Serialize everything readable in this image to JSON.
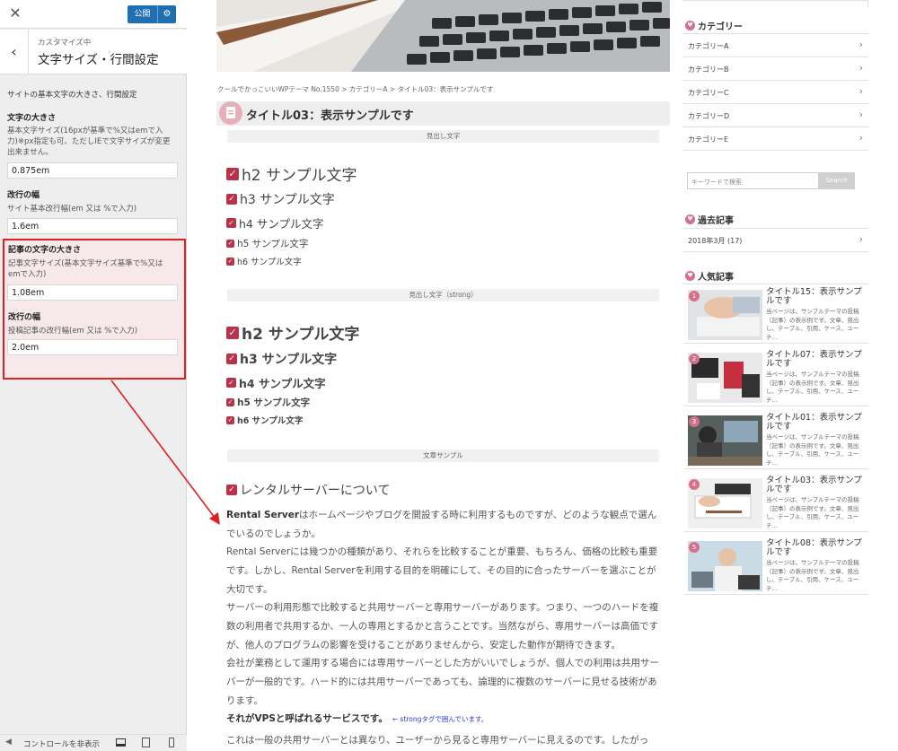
{
  "customizer": {
    "close_icon": "✕",
    "publish_label": "公開",
    "settings_icon": "⚙",
    "back_icon": "‹",
    "customizing_label": "カスタマイズ中",
    "section_title": "文字サイズ・行間設定",
    "section_desc": "サイトの基本文字の大きさ、行間設定",
    "site_font_size": {
      "heading": "文字の大きさ",
      "desc_lines": [
        "基本文字サイズ(16pxが基準で%又はemで入",
        "力)※px指定も可、ただしIEで文字サイズが変更",
        "出来ません。"
      ],
      "value": "0.875em"
    },
    "site_line_height": {
      "heading": "改行の幅",
      "desc": "サイト基本改行幅(em 又は %で入力)",
      "value": "1.6em"
    },
    "post_font_size": {
      "heading": "記事の文字の大きさ",
      "desc_lines": [
        "記事文字サイズ(基本文字サイズ基準で%又は",
        "emで入力)"
      ],
      "value": "1.08em"
    },
    "post_line_height": {
      "heading": "改行の幅",
      "desc": "投稿記事の改行幅(em 又は %で入力)",
      "value": "2.0em"
    },
    "footer": {
      "hide_controls_label": "コントロールを非表示",
      "device_icons": [
        "desktop-icon",
        "tablet-icon",
        "mobile-icon"
      ]
    }
  },
  "article": {
    "breadcrumb": "クールでかっこいいWPテーマ No.1550 > カテゴリーA > タイトル03：表示サンプルです",
    "title": "タイトル03：表示サンプルです",
    "cap_headings": "見出し文字",
    "headings": [
      "h2 サンプル文字",
      "h3 サンプル文字",
      "h4 サンプル文字",
      "h5 サンプル文字",
      "h6 サンプル文字"
    ],
    "cap_headings_strong": "見出し文字（strong）",
    "headings_strong": [
      "h2 サンプル文字",
      "h3 サンプル文字",
      "h4 サンプル文字",
      "h5 サンプル文字",
      "h6 サンプル文字"
    ],
    "cap_text_sample": "文章サンプル",
    "section_heading": "レンタルサーバーについて",
    "p1_strong": "Rental Server",
    "p1_rest": "はホームページやブログを開設する時に利用するものですが、どのような観点で選んでいるのでしょうか。",
    "p2": "Rental Serverには幾つかの種類があり、それらを比較することが重要、もちろん、価格の比較も重要です。しかし、Rental Serverを利用する目的を明確にして、その目的に合ったサーバーを選ぶことが大切です。",
    "p3": "サーバーの利用形態で比較すると共用サーバーと専用サーバーがあります。つまり、一つのハードを複数の利用者で共用するか、一人の専用とするかと言うことです。当然ながら、専用サーバーは高価ですが、他人のプログラムの影響を受けることがありませんから、安定した動作が期待できます。",
    "p4": "会社が業務として運用する場合には専用サーバーとした方がいいでしょうが、個人での利用は共用サーバーが一般的です。ハード的には共用サーバーであっても、論理的に複数のサーバーに見せる技術があります。",
    "p5_strong": "それがVPSと呼ばれるサービスです。",
    "p5_note": "← strongタグで囲んでいます。",
    "p6": "これは一般の共用サーバーとは異なり、ユーザーから見ると専用サーバーに見えるのです。したがっ"
  },
  "sidebar": {
    "categories_title": "カテゴリー",
    "categories": [
      "カテゴリーA",
      "カテゴリーB",
      "カテゴリーC",
      "カテゴリーD",
      "カテゴリーE"
    ],
    "search_placeholder": "キーワードで検索",
    "search_button": "Search",
    "archives_title": "過去記事",
    "archive_item": "2018年3月 (17)",
    "popular_title": "人気記事",
    "popular": [
      {
        "rank": "1",
        "title": "タイトル15：表示サンプルです",
        "excerpt": "当ページは、サンプルテーマの投稿（記事）の表示例です。文章、見出し、テーブル、引用、ケース、ユーチ…"
      },
      {
        "rank": "2",
        "title": "タイトル07：表示サンプルです",
        "excerpt": "当ページは、サンプルテーマの投稿（記事）の表示例です。文章、見出し、テーブル、引用、ケース、ユーチ…"
      },
      {
        "rank": "3",
        "title": "タイトル01：表示サンプルです",
        "excerpt": "当ページは、サンプルテーマの投稿（記事）の表示例です。文章、見出し、テーブル、引用、ケース、ユーチ…"
      },
      {
        "rank": "4",
        "title": "タイトル03：表示サンプルです",
        "excerpt": "当ページは、サンプルテーマの投稿（記事）の表示例です。文章、見出し、テーブル、引用、ケース、ユーチ…"
      },
      {
        "rank": "5",
        "title": "タイトル08：表示サンプルです",
        "excerpt": "当ページは、サンプルテーマの投稿（記事）の表示例です。文章、見出し、テーブル、引用、ケース、ユーチ…"
      }
    ]
  },
  "colors": {
    "accent": "#b8334a",
    "publish": "#1f6fb2",
    "highlight_border": "#e02020"
  }
}
